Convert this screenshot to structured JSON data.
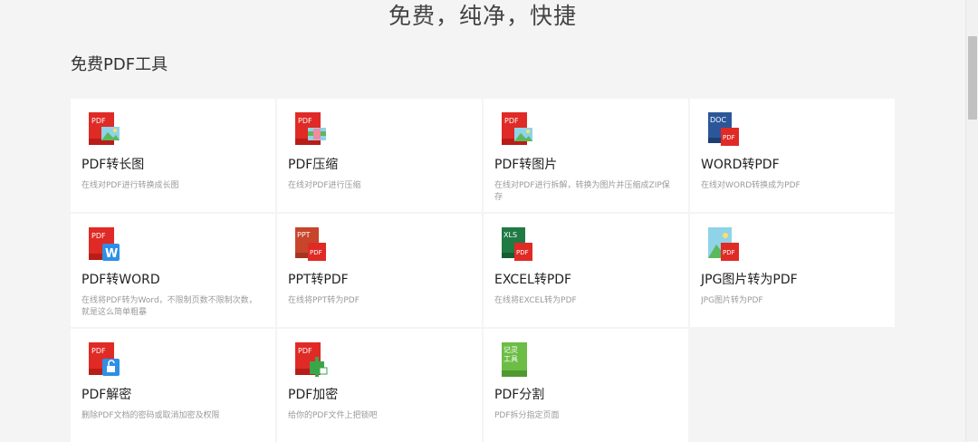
{
  "hero": {
    "title": "免费，纯净，快捷"
  },
  "section": {
    "title": "免费PDF工具"
  },
  "tools": [
    {
      "name": "PDF转长图",
      "desc": "在线对PDF进行转换成长图",
      "icon": "pdf-to-long-image-icon",
      "badge": "PDF"
    },
    {
      "name": "PDF压缩",
      "desc": "在线对PDF进行压缩",
      "icon": "pdf-compress-icon",
      "badge": "PDF"
    },
    {
      "name": "PDF转图片",
      "desc": "在线对PDF进行拆解，转换为图片并压缩成ZIP保存",
      "icon": "pdf-to-image-icon",
      "badge": "PDF"
    },
    {
      "name": "WORD转PDF",
      "desc": "在线对WORD转换成为PDF",
      "icon": "word-to-pdf-icon",
      "badge": "DOC",
      "badge2": "PDF"
    },
    {
      "name": "PDF转WORD",
      "desc": "在线将PDF转为Word，不限制页数不限制次数，就是这么简单粗暴",
      "icon": "pdf-to-word-icon",
      "badge": "PDF",
      "badge2": "W"
    },
    {
      "name": "PPT转PDF",
      "desc": "在线将PPT转为PDF",
      "icon": "ppt-to-pdf-icon",
      "badge": "PPT",
      "badge2": "PDF"
    },
    {
      "name": "EXCEL转PDF",
      "desc": "在线将EXCEL转为PDF",
      "icon": "excel-to-pdf-icon",
      "badge": "XLS",
      "badge2": "PDF"
    },
    {
      "name": "JPG图片转为PDF",
      "desc": "JPG图片转为PDF",
      "icon": "jpg-to-pdf-icon",
      "badge2": "PDF"
    },
    {
      "name": "PDF解密",
      "desc": "删除PDF文档的密码或取消加密及权限",
      "icon": "pdf-decrypt-icon",
      "badge": "PDF"
    },
    {
      "name": "PDF加密",
      "desc": "给你的PDF文件上把锁吧",
      "icon": "pdf-encrypt-icon",
      "badge": "PDF"
    },
    {
      "name": "PDF分割",
      "desc": "PDF拆分指定页面",
      "icon": "pdf-split-icon",
      "badge": "记灵",
      "badge3": "工具"
    }
  ],
  "colors": {
    "pdf_red": "#e02a25",
    "word_blue": "#2b579a",
    "ppt_orange": "#c7452a",
    "excel_green": "#1f7a44",
    "accent_blue": "#2d8fe6"
  }
}
